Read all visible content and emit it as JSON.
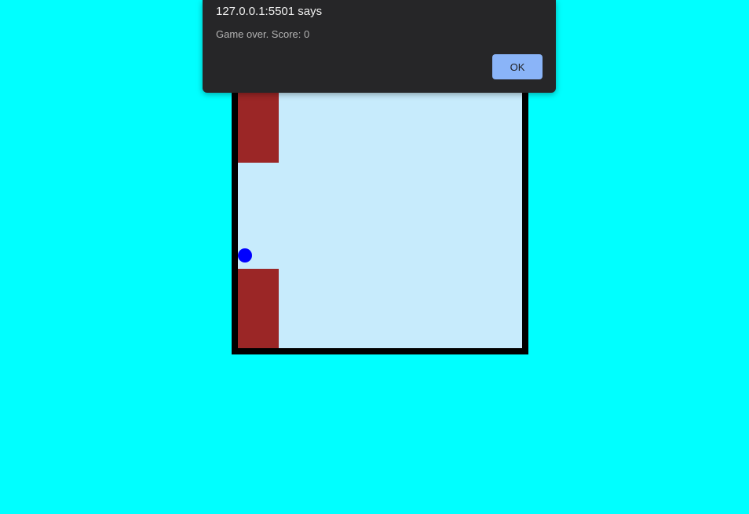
{
  "dialog": {
    "title": "127.0.0.1:5501 says",
    "message": "Game over. Score: 0",
    "ok_label": "OK",
    "button_color": "#8ab4f8"
  },
  "game": {
    "background_color": "#00ffff",
    "board_color": "#c7ebfc",
    "pipe_color": "#9b2626",
    "bird_color": "#0000ff"
  }
}
